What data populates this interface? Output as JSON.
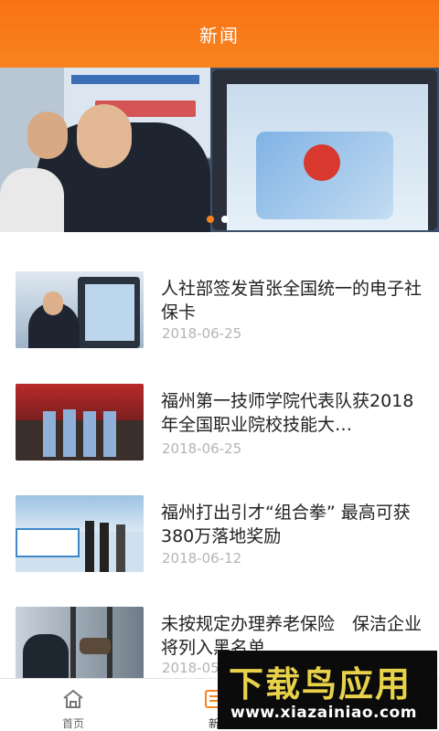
{
  "header": {
    "title": "新闻"
  },
  "banner": {
    "slides": 2,
    "active_slide": 1
  },
  "news": [
    {
      "title": "人社部签发首张全国统一的电子社保卡",
      "date": "2018-06-25"
    },
    {
      "title": "福州第一技师学院代表队获2018年全国职业院校技能大…",
      "date": "2018-06-25"
    },
    {
      "title": "福州打出引才“组合拳” 最高可获380万落地奖励",
      "date": "2018-06-12"
    },
    {
      "title": "未按规定办理养老保险　保洁企业将列入黑名单",
      "date": "2018-05"
    }
  ],
  "tabbar": {
    "tabs": [
      {
        "label": "首页"
      },
      {
        "label": "新"
      }
    ]
  },
  "watermark": {
    "text": "下载鸟应用",
    "url": "www.xiazainiao.com"
  },
  "colors": {
    "accent": "#f8831f",
    "date": "#b4b4b4"
  }
}
